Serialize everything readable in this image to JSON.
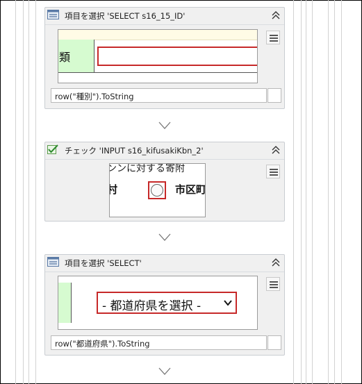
{
  "activities": [
    {
      "title": "項目を選択 'SELECT  s16_15_ID'",
      "icon": "select-item-icon",
      "screenshot_text": "類",
      "expression": "row(\"種別\").ToString"
    },
    {
      "title": "チェック 'INPUT  s16_kifusakiKbn_2'",
      "icon": "check-icon",
      "screenshot_text": {
        "top": "ンンに対する寄附",
        "left": "村",
        "right": "市区町"
      }
    },
    {
      "title": "項目を選択 'SELECT'",
      "icon": "select-item-icon",
      "screenshot_text": "- 都道府県を選択 -",
      "expression": "row(\"都道府県\").ToString"
    }
  ],
  "colors": {
    "highlight": "#c62828",
    "green_cell": "#d6fbd0",
    "card_bg": "#f0f0f0"
  }
}
